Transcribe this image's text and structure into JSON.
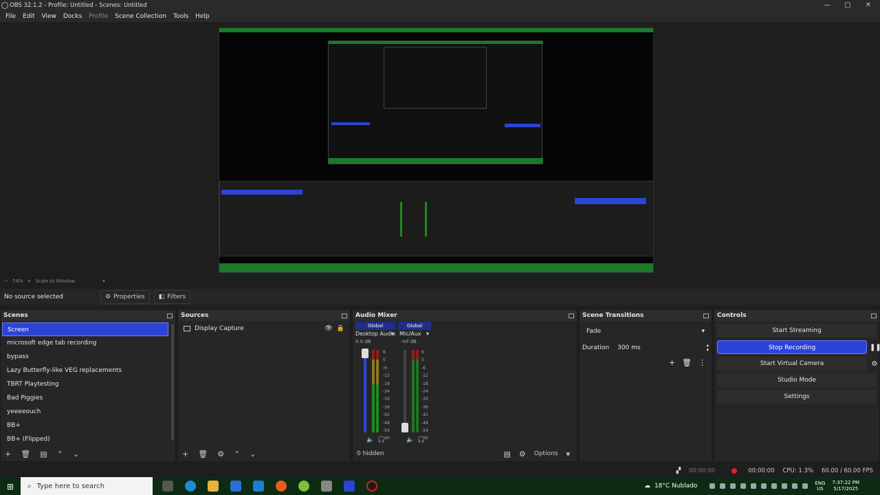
{
  "window": {
    "title": "OBS 32.1.2 - Profile: Untitled - Scenes: Untitled",
    "controls": [
      "—",
      "▢",
      "✕"
    ]
  },
  "menu": [
    "File",
    "Edit",
    "View",
    "Docks",
    "Profile",
    "Scene Collection",
    "Tools",
    "Help"
  ],
  "zoom": {
    "level": "74%",
    "mode": "Scale to Window"
  },
  "source_toolbar": {
    "status": "No source selected",
    "properties_label": "Properties",
    "filters_label": "Filters"
  },
  "scenes": {
    "title": "Scenes",
    "items": [
      "Screen",
      "microsoft edge tab recording",
      "bypass",
      "Lazy Butterfly-like VEG replacements",
      "TBRT Playtesting",
      "Bad Piggies",
      "yeeeeouch",
      "BB+",
      "BB+ (Flipped)"
    ],
    "selected": "Screen"
  },
  "sources": {
    "title": "Sources",
    "items": [
      {
        "label": "Display Capture"
      }
    ]
  },
  "audio_mixer": {
    "title": "Audio Mixer",
    "channels": [
      {
        "tag": "Global",
        "name": "Desktop Audio",
        "db": "0.0 dB",
        "volume_pct": 100
      },
      {
        "tag": "Global",
        "name": "Mic/Aux",
        "db": "-inf dB",
        "volume_pct": 0
      }
    ],
    "ticks": [
      "6",
      "0",
      "-6",
      "-12",
      "-18",
      "-24",
      "-30",
      "-36",
      "-42",
      "-48",
      "-54",
      "-60"
    ],
    "hidden_count": "0 hidden",
    "options_label": "Options"
  },
  "scene_transitions": {
    "title": "Scene Transitions",
    "transition": "Fade",
    "duration_label": "Duration",
    "duration_value": "300 ms"
  },
  "controls": {
    "title": "Controls",
    "start_streaming": "Start Streaming",
    "stop_recording": "Stop Recording",
    "start_virtual_camera": "Start Virtual Camera",
    "studio_mode": "Studio Mode",
    "settings": "Settings"
  },
  "statusbar": {
    "stream_time": "00:00:00",
    "rec_time": "00:00:00",
    "cpu": "CPU: 1.3%",
    "fps": "60.00 / 60.00 FPS"
  },
  "taskbar": {
    "search_placeholder": "Type here to search",
    "weather": "18°C  Nublado",
    "lang": "ENG",
    "region": "US",
    "time": "7:37:22 PM",
    "date": "5/17/2025"
  },
  "colors": {
    "accent": "#2b44d8",
    "recording_red": "#e02020",
    "taskbar": "#0d2b12"
  }
}
